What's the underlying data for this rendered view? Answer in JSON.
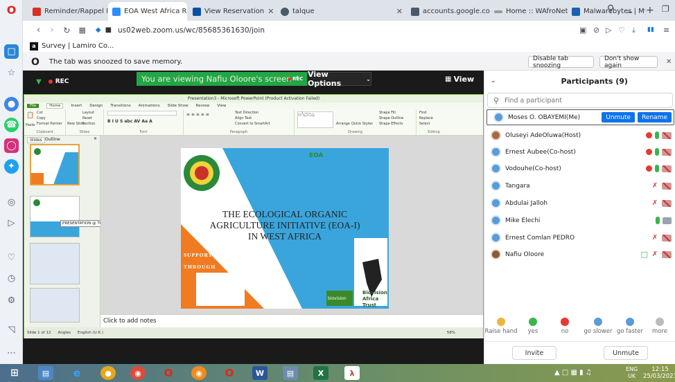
{
  "tabs": [
    {
      "label": "Reminder/Rappel M",
      "fav_color": "#d93025"
    },
    {
      "label": "EOA West Africa RS",
      "fav_color": "#2d8cff"
    },
    {
      "label": "View Reservation",
      "fav_color": "#0b4fa1"
    },
    {
      "label": "talque",
      "fav_color": "#4a5a6b"
    },
    {
      "label": "accounts.google.co",
      "fav_color": "#4a5a6b"
    },
    {
      "label": "Home :: WAfroNet",
      "fav_color": "#999999"
    },
    {
      "label": "Malwarebytes | My",
      "fav_color": "#1b5fb0"
    }
  ],
  "address": {
    "url": "us02web.zoom.us/wc/85685361630/join"
  },
  "bookmark": {
    "label": "Survey | Lamiro Co..."
  },
  "snooze": {
    "message": "The tab was snoozed to save memory.",
    "disable_label": "Disable tab snoozing",
    "dont_show_label": "Don't show again"
  },
  "zoom": {
    "rec_label": "REC",
    "banner_text": "You are viewing Nafiu Oloore's screen",
    "banner_rec": "REC",
    "view_options": "View Options",
    "view_label": "View"
  },
  "ppt": {
    "title": "Presentation3 - Microsoft PowerPoint (Product Activation Failed)",
    "tabs": [
      "File",
      "Home",
      "Insert",
      "Design",
      "Transitions",
      "Animations",
      "Slide Show",
      "Review",
      "View"
    ],
    "ribbon_groups": [
      "Clipboard",
      "Slides",
      "Font",
      "Paragraph",
      "Drawing",
      "Editing"
    ],
    "ribbon_items": {
      "cut": "Cut",
      "copy": "Copy",
      "format_painter": "Format Painter",
      "paste": "Paste",
      "new_slide": "New Slide",
      "layout": "Layout",
      "reset": "Reset",
      "section": "Section",
      "text_direction": "Text Direction",
      "align_text": "Align Text",
      "convert_smartart": "Convert to SmartArt",
      "arrange": "Arrange",
      "quick_styles": "Quick Styles",
      "shape_fill": "Shape Fill",
      "shape_outline": "Shape Outline",
      "shape_effects": "Shape Effects",
      "find": "Find",
      "replace": "Replace",
      "select": "Select"
    },
    "thumbs_tabs": [
      "Slides",
      "Outline"
    ],
    "thumb_numbers": [
      "1",
      "2",
      "3",
      "4"
    ],
    "tooltip": "PRESENTATION @ THE REGION...",
    "slide": {
      "eoa_logo": "EOA",
      "title_lines": [
        "THE ECOLOGICAL ORGANIC",
        "AGRICULTURE INITIATIVE  (EOA-I)",
        "IN WEST AFRICA"
      ],
      "supported_by": "SUPPORTED BY",
      "through": "THROUGH",
      "biovision_line1": "Biovision",
      "biovision_line2": "Africa Trust",
      "biovision_small": "biovision"
    },
    "notes_placeholder": "Click to add notes",
    "status_text": "Slide 1 of 12",
    "status_theme": "Angles",
    "status_lang": "English (U.K.)",
    "zoom_pct": "58%"
  },
  "participants": {
    "header": "Participants (9)",
    "search_placeholder": "Find a participant",
    "list": [
      {
        "name": "Moses O. OBAYEMI(Me)",
        "unmute": "Unmute",
        "rename": "Rename"
      },
      {
        "name": "Oluseyi AdeOluwa(Host)"
      },
      {
        "name": "Ernest Aubee(Co-host)"
      },
      {
        "name": "Vodouhe(Co-host)"
      },
      {
        "name": "Tangara"
      },
      {
        "name": "Abdulai Jalloh"
      },
      {
        "name": "Mike Elechi"
      },
      {
        "name": "Ernest Comlan PEDRO"
      },
      {
        "name": "Nafiu Oloore"
      }
    ],
    "reactions": [
      {
        "label": "Raise hand",
        "color": "#f2b33d"
      },
      {
        "label": "yes",
        "color": "#3ab54a"
      },
      {
        "label": "no",
        "color": "#e8382f"
      },
      {
        "label": "go slower",
        "color": "#5a9bd8"
      },
      {
        "label": "go faster",
        "color": "#5a9bd8"
      },
      {
        "label": "more",
        "color": "#999999"
      }
    ],
    "invite": "Invite",
    "unmute": "Unmute"
  },
  "taskbar": {
    "lang_line1": "ENG",
    "lang_line2": "UK",
    "time": "12:15",
    "date": "25/03/2021"
  }
}
